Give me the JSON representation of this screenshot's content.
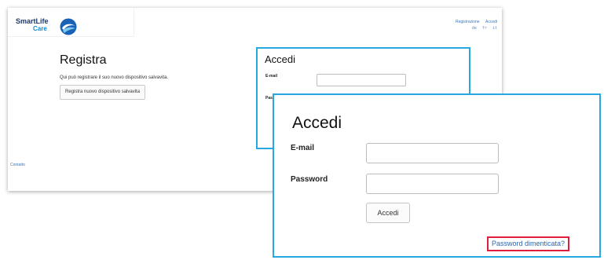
{
  "logo": {
    "line1": "SmartLife",
    "line2": "Care"
  },
  "header": {
    "links": [
      "Registrazione",
      "Accedi"
    ],
    "languages": [
      "de",
      "fr",
      "it"
    ]
  },
  "register": {
    "title": "Registra",
    "description": "Qui può registrare il suo nuovo dispositivo salvavita.",
    "button_label": "Registra nuovo dispositivo salvavita"
  },
  "footer": {
    "link": "Contatto"
  },
  "login_small": {
    "title": "Accedi",
    "email_label": "E-mail",
    "password_label_partial": "Pas"
  },
  "login": {
    "title": "Accedi",
    "email_label": "E-mail",
    "email_value": "",
    "password_label": "Password",
    "password_value": "",
    "submit_label": "Accedi",
    "forgot_label": "Password dimenticata?"
  },
  "colors": {
    "highlight_box": "#27a8e0",
    "forgot_highlight": "#e01f3d",
    "link": "#2a68b0"
  }
}
